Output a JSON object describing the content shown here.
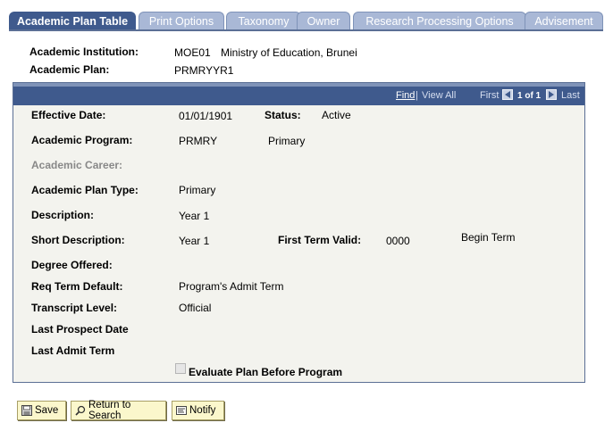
{
  "tabs": [
    {
      "label": "Academic Plan Table",
      "active": true
    },
    {
      "label": "Print Options"
    },
    {
      "label": "Taxonomy"
    },
    {
      "label": "Owner"
    },
    {
      "label": "Research Processing Options"
    },
    {
      "label": "Advisement"
    }
  ],
  "header": {
    "institution_label": "Academic Institution:",
    "institution_code": "MOE01",
    "institution_name": "Ministry of Education, Brunei",
    "plan_label": "Academic Plan:",
    "plan_value": "PRMRYYR1"
  },
  "scroll_nav": {
    "find": "Find",
    "view_all": "View All",
    "first": "First",
    "count": "1 of 1",
    "last": "Last"
  },
  "fields": {
    "effective_date_label": "Effective Date:",
    "effective_date": "01/01/1901",
    "status_label": "Status:",
    "status": "Active",
    "program_label": "Academic Program:",
    "program_code": "PRMRY",
    "program_desc": "Primary",
    "career_label": "Academic Career:",
    "plan_type_label": "Academic Plan Type:",
    "plan_type": "Primary",
    "description_label": "Description:",
    "description": "Year 1",
    "short_desc_label": "Short Description:",
    "short_desc": "Year 1",
    "first_term_label": "First Term Valid:",
    "first_term": "0000",
    "first_term_desc": "Begin Term",
    "degree_label": "Degree Offered:",
    "req_term_label": "Req Term Default:",
    "req_term": "Program's Admit Term",
    "transcript_label": "Transcript Level:",
    "transcript": "Official",
    "last_prospect_label": "Last Prospect Date",
    "last_admit_label": "Last Admit Term",
    "evaluate_label": "Evaluate Plan Before Program",
    "evaluate_checked": false
  },
  "buttons": {
    "save": "Save",
    "return": "Return to Search",
    "notify": "Notify"
  }
}
